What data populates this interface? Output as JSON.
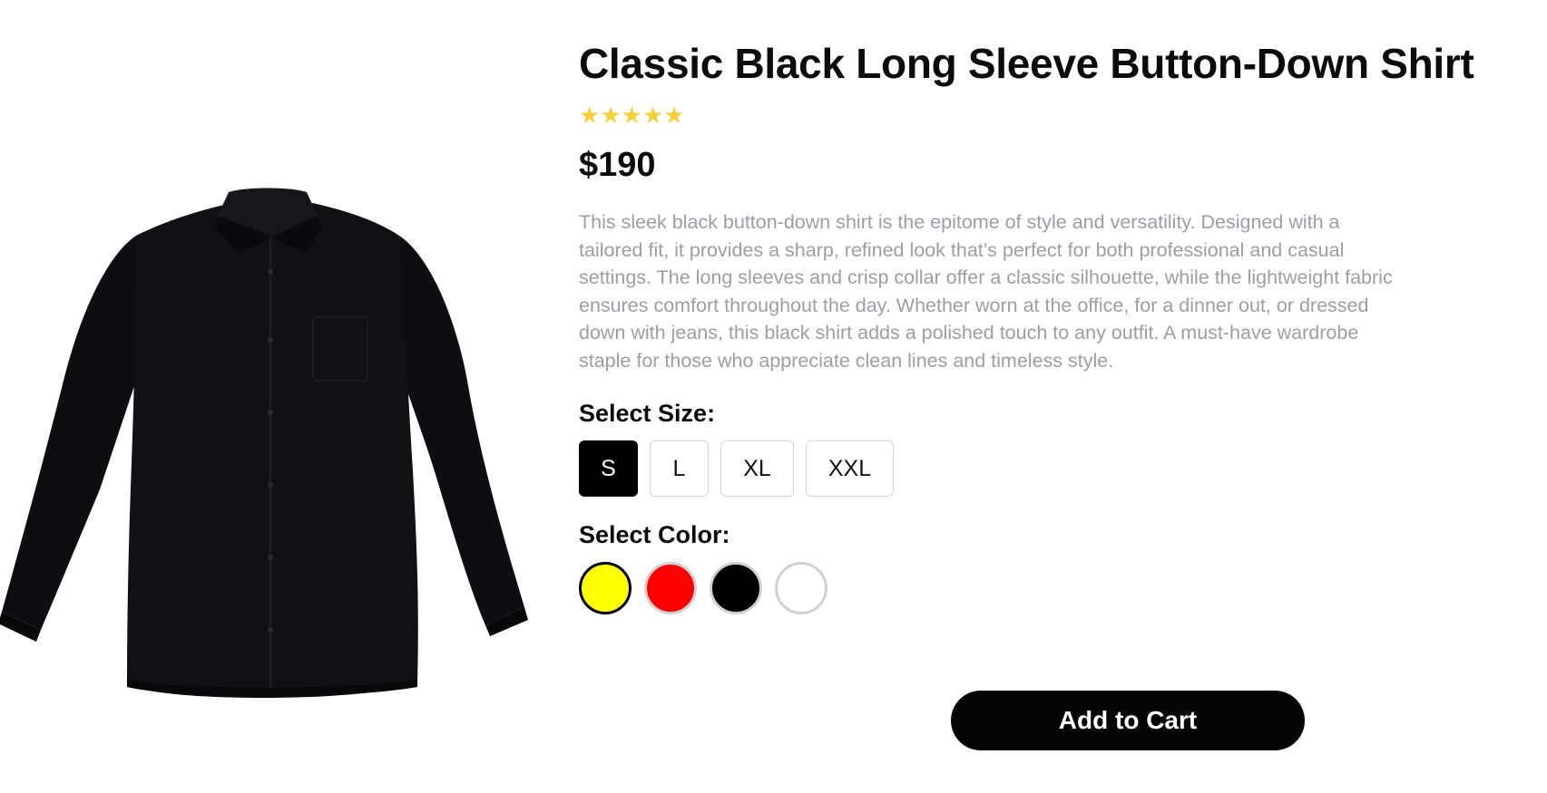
{
  "product": {
    "title": "Classic Black Long Sleeve Button-Down Shirt",
    "rating": 5,
    "price": "$190",
    "description": "This sleek black button-down shirt is the epitome of style and versatility. Designed with a tailored fit, it provides a sharp, refined look that’s perfect for both professional and casual settings. The long sleeves and crisp collar offer a classic silhouette, while the lightweight fabric ensures comfort throughout the day. Whether worn at the office, for a dinner out, or dressed down with jeans, this black shirt adds a polished touch to any outfit. A must-have wardrobe staple for those who appreciate clean lines and timeless style.",
    "image_icon": "black-shirt-image"
  },
  "size_section": {
    "label": "Select Size:",
    "options": [
      "S",
      "L",
      "XL",
      "XXL"
    ],
    "selected": "S"
  },
  "color_section": {
    "label": "Select Color:",
    "options": [
      "#ffff00",
      "#ff0000",
      "#000000",
      "#ffffff"
    ],
    "selected": "#ffff00"
  },
  "cart": {
    "label": "Add to Cart"
  },
  "colors": {
    "star": "#f5cf3c",
    "description_text": "#9a9ea6",
    "button_bg": "#050505"
  }
}
